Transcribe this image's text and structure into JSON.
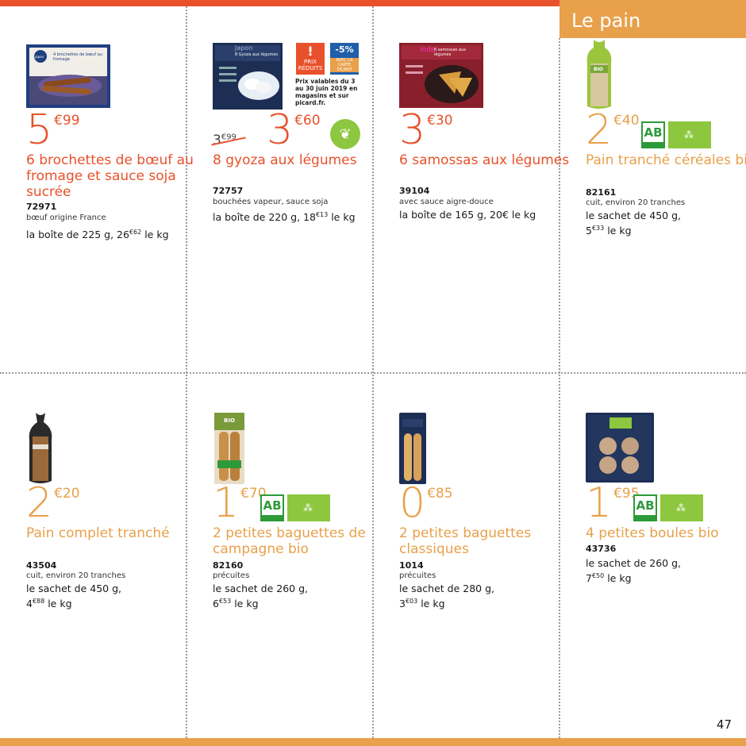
{
  "section_title": "Le pain",
  "page_number": "47",
  "colors": {
    "red": "#e8512b",
    "orange": "#e8a04a",
    "bio_green": "#2d9a3a",
    "eu_leaf": "#8dc63f"
  },
  "products": [
    {
      "price_int": "5",
      "price_cents": "€99",
      "name": "6 brochettes de bœuf au fromage et sauce soja sucrée",
      "ref": "72971",
      "desc": "bœuf origine France",
      "pack_main": "la boîte de 225 g, 26",
      "pack_sup": "€62",
      "pack_tail": " le kg",
      "box_label": "4 brochettes de bœuf au fromage",
      "box_brand": "japon"
    },
    {
      "old_price": "3",
      "old_price_sup": "€99",
      "price_int": "3",
      "price_cents": "€60",
      "name": "8 gyoza aux légumes",
      "ref": "72757",
      "desc": "bouchées vapeur, sauce soja",
      "pack_main": "la boîte de 220 g, 18",
      "pack_sup": "€13",
      "pack_tail": " le kg",
      "box_label": "8 Gyoza aux légumes",
      "box_brand": "Japon",
      "badge_prix_top": "!",
      "badge_prix_text": "PRIX RÉDUITS",
      "badge_pct": "-5%",
      "badge_pct_text": "AVEC LA CARTE PICARD",
      "promo_note": "Prix valables du 3 au 30 juin 2019 en magasins et sur picard.fr."
    },
    {
      "price_int": "3",
      "price_cents": "€30",
      "name": "6 samossas aux légumes",
      "ref": "39104",
      "desc": "avec sauce aigre-douce",
      "pack_main": "la boîte de 165 g, 20€ le kg",
      "box_label": "6 samossas aux légumes",
      "box_brand": "inde"
    },
    {
      "price_int": "2",
      "price_cents": "€40",
      "name": "Pain tranché céréales bio",
      "ref": "82161",
      "desc": "cuit, environ 20 tranches",
      "pack_main": "le sachet de 450 g,",
      "pack_line2_sup": "€33",
      "pack_line2_int": "5",
      "pack_tail": " le kg",
      "bio_label": "AB",
      "bio_pack_label": "BIO"
    },
    {
      "price_int": "2",
      "price_cents": "€20",
      "name": "Pain complet tranché",
      "ref": "43504",
      "desc": "cuit, environ 20 tranches",
      "pack_main": "le sachet de 450 g,",
      "pack_line2_int": "4",
      "pack_line2_sup": "€88",
      "pack_tail": " le kg"
    },
    {
      "price_int": "1",
      "price_cents": "€70",
      "name": "2 petites baguettes de campagne bio",
      "ref": "82160",
      "desc": "précuites",
      "pack_main": "le sachet de 260 g,",
      "pack_line2_int": "6",
      "pack_line2_sup": "€53",
      "pack_tail": " le kg",
      "bio_label": "AB",
      "bio_pack_label": "BIO"
    },
    {
      "price_int": "0",
      "price_cents": "€85",
      "name": "2 petites baguettes classiques",
      "ref": "1014",
      "desc": "précuites",
      "pack_main": "le sachet de 280 g,",
      "pack_line2_int": "3",
      "pack_line2_sup": "€03",
      "pack_tail": " le kg"
    },
    {
      "price_int": "1",
      "price_cents": "€95",
      "name": "4 petites boules bio",
      "ref": "43736",
      "desc": "",
      "pack_main": "le sachet de 260 g,",
      "pack_line2_int": "7",
      "pack_line2_sup": "€50",
      "pack_tail": " le kg",
      "bio_label": "AB"
    }
  ]
}
